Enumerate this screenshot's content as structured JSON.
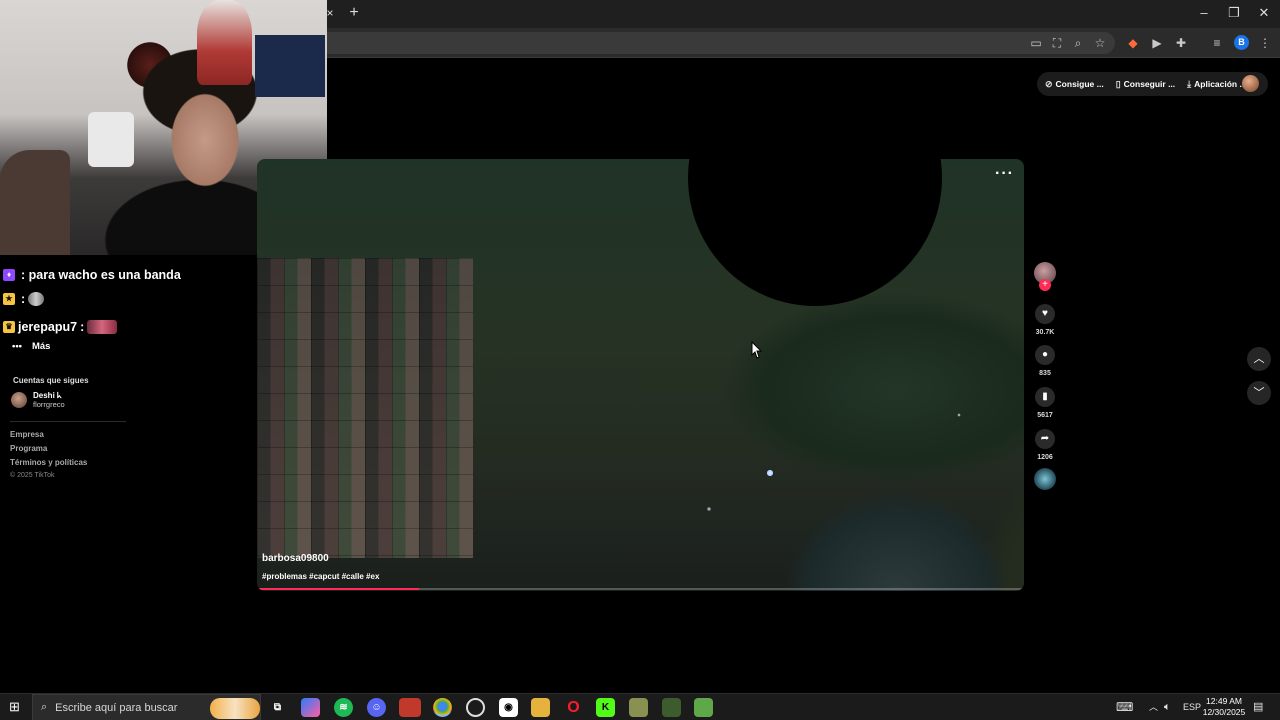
{
  "browser": {
    "tab_close": "×",
    "tab_new": "+",
    "window_controls": {
      "minimize": "–",
      "restore": "❐",
      "close": "✕"
    },
    "profile_initial": "B"
  },
  "tiktok_header": {
    "items": [
      {
        "label": "Consigue ...",
        "icon": "coin-icon"
      },
      {
        "label": "Conseguir ...",
        "icon": "phone-icon"
      },
      {
        "label": "Aplicación ...",
        "icon": "download-icon"
      }
    ]
  },
  "chat": {
    "lines": [
      {
        "user": "",
        "message": ": para wacho es una banda",
        "user_color": "#8fb7ff"
      },
      {
        "user": "",
        "message": ":",
        "user_color": "#ff4d8d"
      },
      {
        "user": "jerepapu7",
        "message": ":",
        "user_color": "#ffffff"
      }
    ]
  },
  "sidebar": {
    "more_label": "Más",
    "following_title": "Cuentas que sigues",
    "following": [
      {
        "name": "Deshi ᖾ",
        "handle": "florrgreco"
      }
    ],
    "footer_links": [
      "Empresa",
      "Programa",
      "Términos y políticas"
    ],
    "copyright": "© 2025 TikTok"
  },
  "video": {
    "author": "barbosa09800",
    "description": "#problemas #capcut #calle #ex",
    "progress": 0.21,
    "more_label": "···"
  },
  "actions": {
    "likes": "30.7K",
    "comments": "835",
    "saves": "5617",
    "shares": "1206"
  },
  "taskbar": {
    "search_placeholder": "Escribe aquí para buscar",
    "language": "ESP",
    "time": "12:49 AM",
    "date": "12/30/2025"
  },
  "colors": {
    "accent": "#fe2c55",
    "taskbar": "#1b1b1b",
    "chrome_toolbar": "#2b2b2b"
  }
}
